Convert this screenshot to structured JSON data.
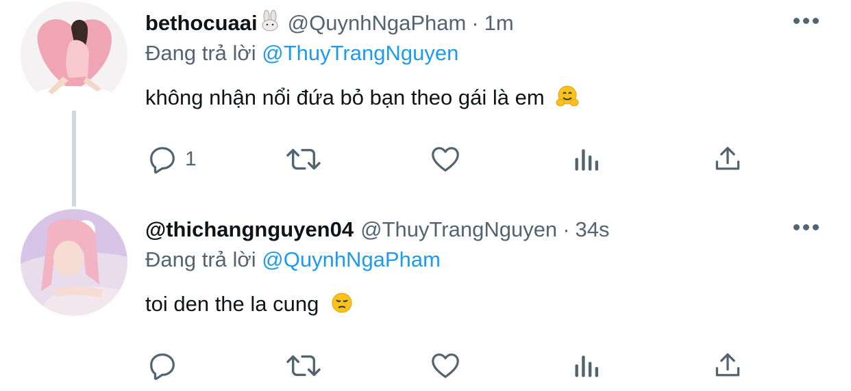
{
  "tweets": [
    {
      "display_name": "bethocuaai",
      "handle": "@QuynhNgaPham",
      "separator": "·",
      "time": "1m",
      "replying_prefix": "Đang trả lời",
      "replying_to": "@ThuyTrangNguyen",
      "text": "không nhận nổi đứa bỏ bạn theo gái là em",
      "emoji": "hugging-face",
      "reply_count": "1"
    },
    {
      "display_name": "@thichangnguyen04",
      "handle": "@ThuyTrangNguyen",
      "separator": "·",
      "time": "34s",
      "replying_prefix": "Đang trả lời",
      "replying_to": "@QuynhNgaPham",
      "text": "toi den the la cung",
      "emoji": "pensive-face",
      "reply_count": ""
    }
  ],
  "colors": {
    "text": "#0f1419",
    "secondary": "#536471",
    "link": "#1d9bf0",
    "thread_line": "#cfd9de"
  },
  "icons": [
    "reply-icon",
    "retweet-icon",
    "like-icon",
    "analytics-icon",
    "share-icon",
    "more-icon"
  ]
}
